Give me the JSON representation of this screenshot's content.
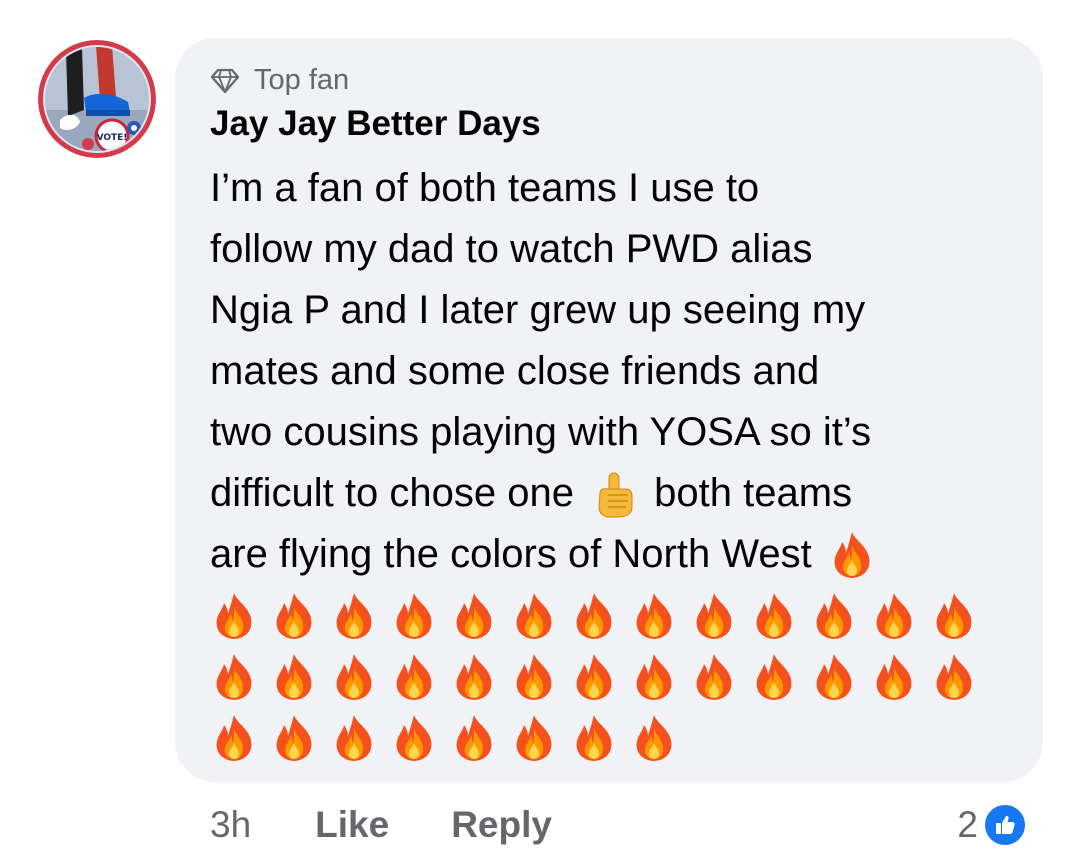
{
  "comment": {
    "badge_label": "Top fan",
    "badge_icon": "diamond-icon",
    "author_name": "Jay Jay Better Days",
    "lines": [
      "I’m a fan of both teams I use to",
      "follow my dad to watch PWD alias",
      "Ngia P and I later grew up seeing my",
      "mates and some close friends and",
      "two cousins playing with YOSA so it’s"
    ],
    "line6_before": "difficult to chose one ",
    "line6_emoji": "point-up-emoji",
    "line6_after": " both teams",
    "line7_text": "are flying the colors of North West ",
    "line7_emoji": "fire-emoji",
    "fire_rows": [
      13,
      13,
      8
    ]
  },
  "footer": {
    "time": "3h",
    "like_label": "Like",
    "reply_label": "Reply",
    "reaction_count": "2",
    "reaction_icon": "thumbs-up-icon"
  },
  "colors": {
    "bubble": "#f0f2f5",
    "text": "#050505",
    "secondary": "#65676b",
    "like_blue": "#1877f2"
  }
}
